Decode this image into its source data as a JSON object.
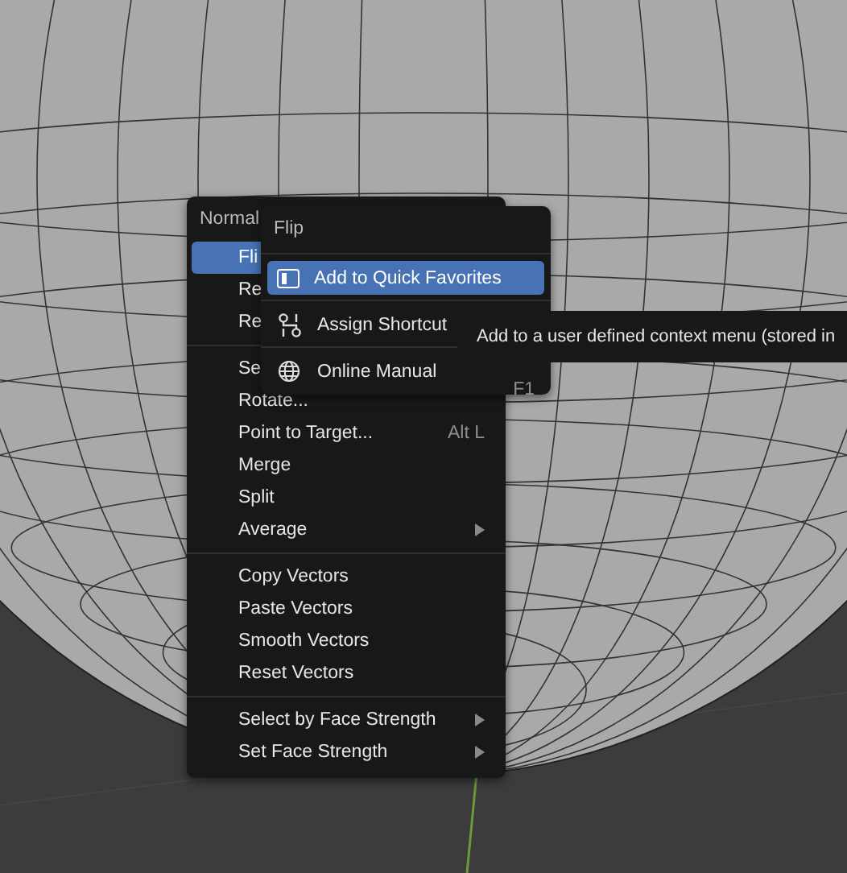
{
  "menu": {
    "title": "Normal",
    "groups": [
      [
        {
          "label": "Fli",
          "selected": true
        },
        {
          "label": "Re",
          "selected": false
        },
        {
          "label": "Re",
          "selected": false
        }
      ],
      [
        {
          "label": "Se",
          "selected": false
        },
        {
          "label": "Rotate...",
          "selected": false
        },
        {
          "label": "Point to Target...",
          "selected": false,
          "shortcut": "Alt L"
        },
        {
          "label": "Merge",
          "selected": false
        },
        {
          "label": "Split",
          "selected": false
        },
        {
          "label": "Average",
          "selected": false,
          "submenu": true
        }
      ],
      [
        {
          "label": "Copy Vectors",
          "selected": false
        },
        {
          "label": "Paste Vectors",
          "selected": false
        },
        {
          "label": "Smooth Vectors",
          "selected": false
        },
        {
          "label": "Reset Vectors",
          "selected": false
        }
      ],
      [
        {
          "label": "Select by Face Strength",
          "selected": false,
          "submenu": true
        },
        {
          "label": "Set Face Strength",
          "selected": false,
          "submenu": true
        }
      ]
    ]
  },
  "context_menu": {
    "title": "Flip",
    "items": [
      {
        "kind": "favorites",
        "label": "Add to Quick Favorites",
        "selected": true
      },
      {
        "kind": "shortcut",
        "label": "Assign Shortcut",
        "selected": false
      },
      {
        "kind": "manual",
        "label": "Online Manual",
        "selected": false,
        "shortcut": "F1"
      }
    ]
  },
  "tooltip": {
    "text": "Add to a user defined context menu (stored in"
  }
}
